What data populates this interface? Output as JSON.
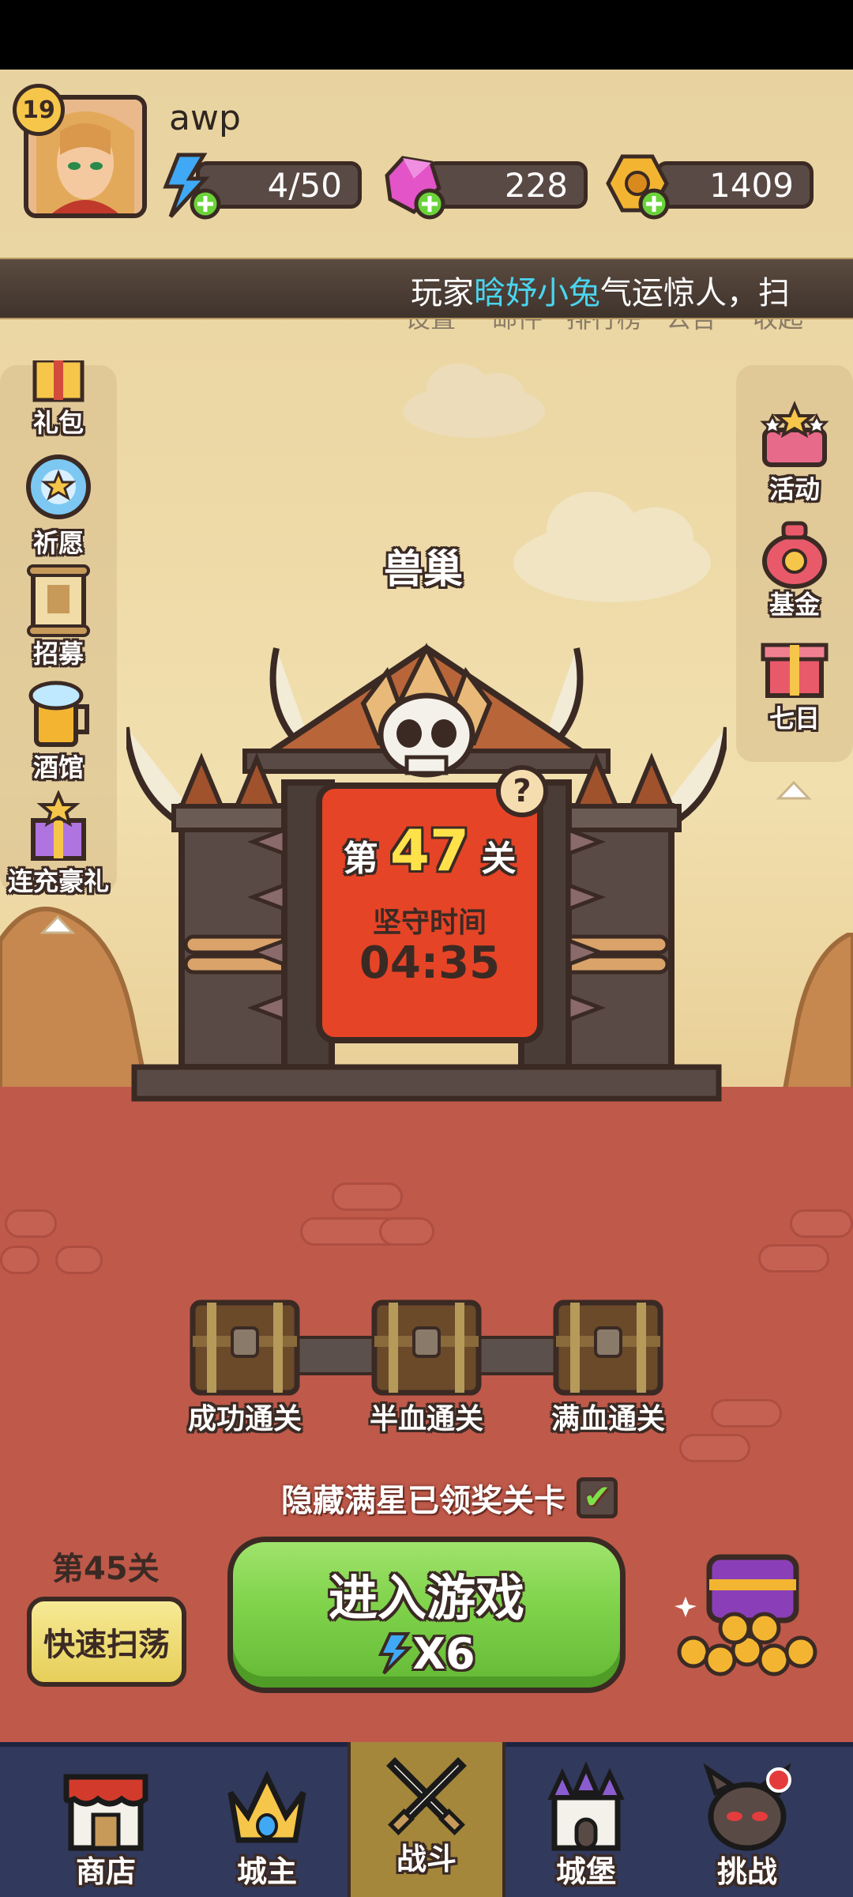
{
  "player": {
    "level": "19",
    "name": "awp"
  },
  "resources": {
    "energy": "4/50",
    "gems": "228",
    "gold": "1409"
  },
  "ticker": {
    "prefix": "玩家",
    "player_name": "晗妤小兔",
    "suffix": "气运惊人，扫",
    "menu": [
      "设置",
      "邮件",
      "排行榜",
      "公告",
      "收起"
    ]
  },
  "left_menu": [
    "礼包",
    "祈愿",
    "招募",
    "酒馆",
    "连充豪礼"
  ],
  "right_menu": [
    "活动",
    "基金",
    "七日"
  ],
  "stage": {
    "name": "兽巢",
    "level_prefix": "第",
    "level_number": "47",
    "level_suffix": "关",
    "hold_label": "坚守时间",
    "hold_time": "04:35",
    "help": "?"
  },
  "chests": [
    "成功通关",
    "半血通关",
    "满血通关"
  ],
  "hide_option": {
    "label": "隐藏满星已领奖关卡",
    "checked": "✔"
  },
  "sweep": {
    "level": "第45关",
    "button": "快速扫荡"
  },
  "enter_game": {
    "title": "进入游戏",
    "cost": "X6"
  },
  "nav": [
    "商店",
    "城主",
    "战斗",
    "城堡",
    "挑战"
  ],
  "colors": {
    "sky": "#edd9a6",
    "ground": "#bf594a",
    "enter_button": "#7fd24a",
    "nav_bg": "#31395c",
    "nav_active": "#a4873b"
  }
}
